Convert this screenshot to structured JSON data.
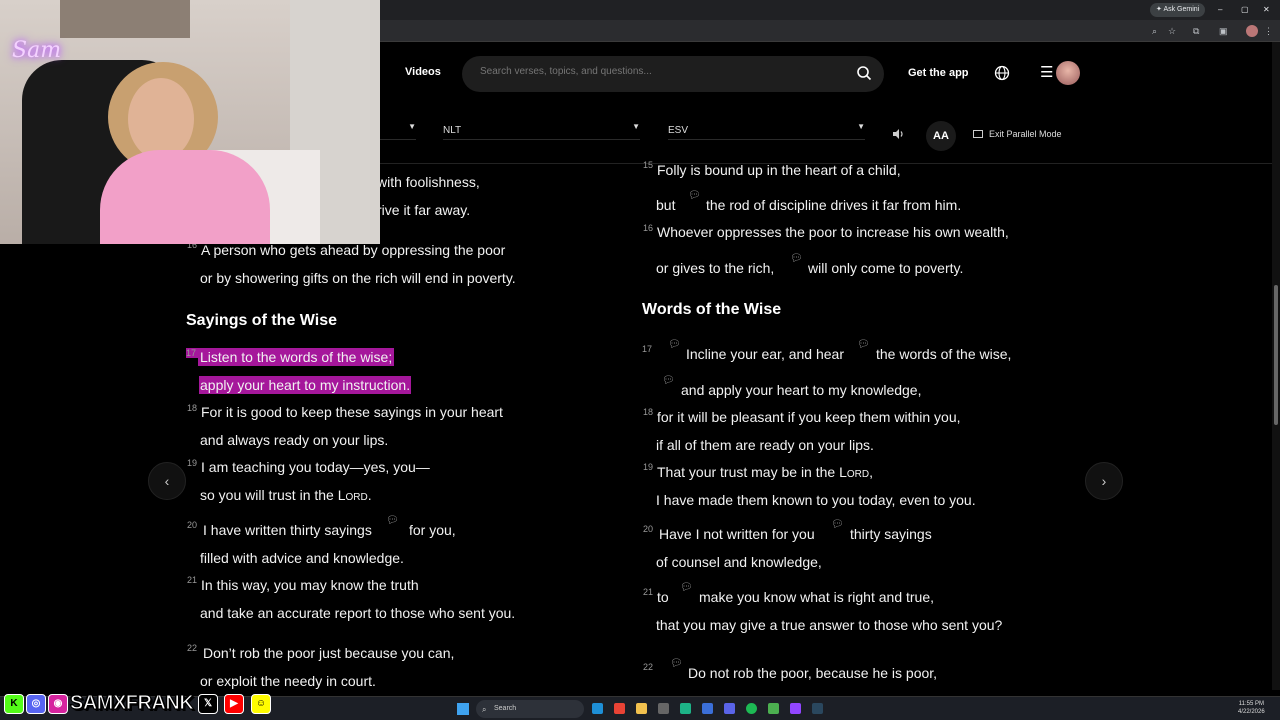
{
  "browser": {
    "gemini_label": "Ask Gemini",
    "window_controls": [
      "–",
      "▢",
      "✕"
    ]
  },
  "nav": {
    "partial_link": "s",
    "videos": "Videos",
    "search_placeholder": "Search verses, topics, and questions...",
    "get_app": "Get the app"
  },
  "versions": {
    "first": "",
    "second": "NLT",
    "third": "ESV",
    "text_size": "AA",
    "exit_parallel": "Exit Parallel Mode"
  },
  "left": {
    "l1": "with foolishness,",
    "l2": "rive it far away.",
    "v16n": "16",
    "v16a": "A person who gets ahead by oppressing the poor",
    "v16b": "or by showering gifts on the rich will end in poverty.",
    "heading": "Sayings of the Wise",
    "v17n": "17",
    "v17a": "Listen to the words of the wise;",
    "v17b": "apply your heart to my instruction.",
    "v18n": "18",
    "v18a": "For it is good to keep these sayings in your heart",
    "v18b": "and always ready on your lips.",
    "v19n": "19",
    "v19a": "I am teaching you today—yes, you—",
    "v19b": "so you will trust in the L",
    "v19c": "ORD",
    "v19d": ".",
    "v20n": "20",
    "v20a": "I have written thirty sayings",
    "v20b": "for you,",
    "v20c": "filled with advice and knowledge.",
    "v21n": "21",
    "v21a": "In this way, you may know the truth",
    "v21b": "and take an accurate report to those who sent you.",
    "v22n": "22",
    "v22a": "Don’t rob the poor just because you can,",
    "v22b": "or exploit the needy in court."
  },
  "right": {
    "v15n": "15",
    "v15a": "Folly is bound up in the heart of a child,",
    "v15b1": "but",
    "v15b2": "the rod of discipline drives it far from him.",
    "v16n": "16",
    "v16a": "Whoever oppresses the poor to increase his own wealth,",
    "v16b1": "or gives to the rich,",
    "v16b2": "will only come to poverty.",
    "heading": "Words of the Wise",
    "v17n": "17",
    "v17a1": "Incline your ear, and hear",
    "v17a2": "the words of the wise,",
    "v17b": "and apply your heart to my knowledge,",
    "v18n": "18",
    "v18a": "for it will be pleasant if you keep them within you,",
    "v18b": "if all of them are ready on your lips.",
    "v19n": "19",
    "v19a1": "That your trust may be in the L",
    "v19a2": "ORD",
    "v19a3": ",",
    "v19b": "I have made them known to you today, even to you.",
    "v20n": "20",
    "v20a1": "Have I not written for you",
    "v20a2": "thirty sayings",
    "v20b": "of counsel and knowledge,",
    "v21n": "21",
    "v21a1": "to",
    "v21a2": "make you know what is right and true,",
    "v21b": "that you may give a true answer to those who sent you?",
    "v22n": "22",
    "v22a": "Do not rob the poor, because he is poor,"
  },
  "overlay": {
    "neon_sign": "Sam",
    "social_name": "SAMXFRANK",
    "social_icons": [
      "kick-icon",
      "discord-icon",
      "instagram-icon",
      "x-icon",
      "youtube-icon",
      "snapchat-icon"
    ]
  },
  "taskbar": {
    "search": "Search",
    "time": "11:55 PM",
    "date": "4/22/2026"
  },
  "colors": {
    "highlight": "#a5179b",
    "page_bg": "#000000"
  }
}
